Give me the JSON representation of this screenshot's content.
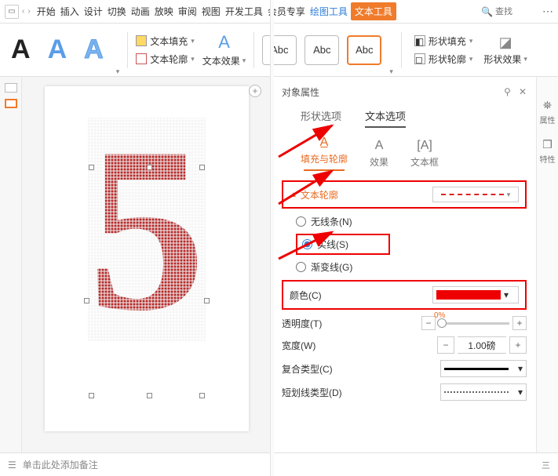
{
  "menubar": {
    "tabs": [
      "开始",
      "插入",
      "设计",
      "切换",
      "动画",
      "放映",
      "审阅",
      "视图",
      "开发工具",
      "会员专享"
    ],
    "tab_draw": "绘图工具",
    "tab_text": "文本工具",
    "search_placeholder": "查找"
  },
  "ribbon": {
    "text_fill": "文本填充",
    "text_outline": "文本轮廓",
    "text_effect": "文本效果",
    "abc": "Abc",
    "shape_fill": "形状填充",
    "shape_outline": "形状轮廓",
    "shape_effect": "形状效果"
  },
  "panel": {
    "title": "对象属性",
    "tab_shape": "形状选项",
    "tab_text": "文本选项",
    "sub_fill": "填充与轮廓",
    "sub_effect": "效果",
    "sub_textbox": "文本框",
    "section_outline": "文本轮廓",
    "radio_none": "无线条(N)",
    "radio_solid": "实线(S)",
    "radio_gradient": "渐变线(G)",
    "lbl_color": "颜色(C)",
    "lbl_opacity": "透明度(T)",
    "opacity_pct": "0%",
    "lbl_width": "宽度(W)",
    "width_val": "1.00磅",
    "lbl_compound": "复合类型(C)",
    "lbl_dash": "短划线类型(D)"
  },
  "rside": {
    "prop": "属性",
    "feat": "特性"
  },
  "footer": {
    "note": "单击此处添加备注",
    "right": "三"
  },
  "canvas": {
    "digit": "5"
  }
}
